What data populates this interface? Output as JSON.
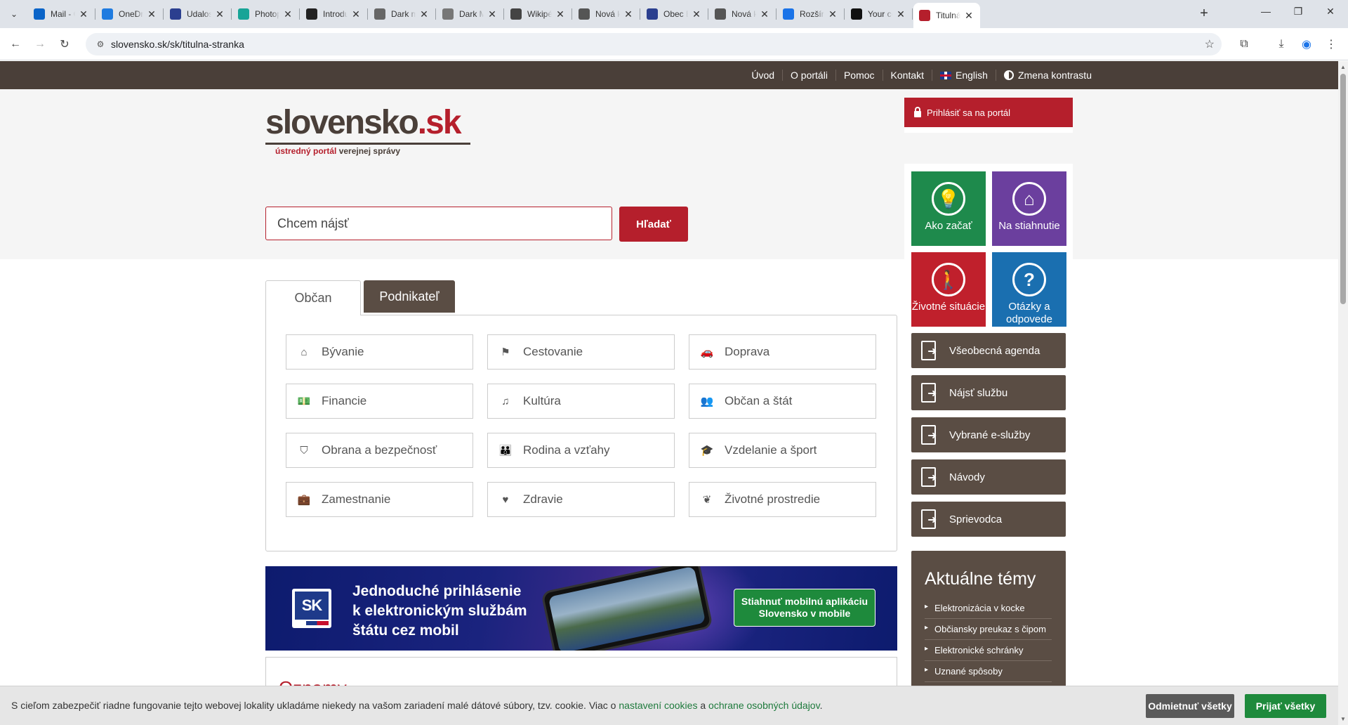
{
  "browser": {
    "tabs": [
      {
        "title": "Mail - Ol",
        "icon": "outlook-icon",
        "color": "#0a64c8"
      },
      {
        "title": "OneDrive",
        "icon": "onedrive-icon",
        "color": "#1f7be0"
      },
      {
        "title": "Udalosti",
        "icon": "coat-of-arms-icon",
        "color": "#2b3f8f"
      },
      {
        "title": "Photope",
        "icon": "photopea-icon",
        "color": "#18a497"
      },
      {
        "title": "Introduc",
        "icon": "openai-icon",
        "color": "#222222"
      },
      {
        "title": "Dark mo",
        "icon": "extension-page-icon",
        "color": "#666666"
      },
      {
        "title": "Dark Mo",
        "icon": "globe-icon",
        "color": "#777777"
      },
      {
        "title": "Wikipédi",
        "icon": "wikipedia-icon",
        "color": "#444444"
      },
      {
        "title": "Nová kar",
        "icon": "chrome-icon",
        "color": "#555555"
      },
      {
        "title": "Obec Ba",
        "icon": "coat-of-arms-icon",
        "color": "#2b3f8f"
      },
      {
        "title": "Nová kar",
        "icon": "chrome-icon",
        "color": "#555555"
      },
      {
        "title": "Rozšíren",
        "icon": "puzzle-icon",
        "color": "#1a73e8"
      },
      {
        "title": "Your con",
        "icon": "notion-icon",
        "color": "#111111"
      },
      {
        "title": "Titulná s",
        "icon": "sk-icon",
        "color": "#b51f2c",
        "active": true
      }
    ],
    "url": "slovensko.sk/sk/titulna-stranka"
  },
  "topnav": {
    "links": [
      "Úvod",
      "O portáli",
      "Pomoc",
      "Kontakt",
      "English",
      "Zmena kontrastu"
    ]
  },
  "logo": {
    "word": "slovensko",
    "tld": ".sk",
    "tagline_a": "ústredný portál",
    "tagline_b": "verejnej správy"
  },
  "search": {
    "placeholder": "Chcem nájsť",
    "button": "Hľadať"
  },
  "login": {
    "label": "Prihlásiť sa na portál"
  },
  "tabs": {
    "citizen": "Občan",
    "business": "Podnikateľ"
  },
  "categories": [
    {
      "label": "Bývanie",
      "icon": "home-icon",
      "glyph": "⌂"
    },
    {
      "label": "Cestovanie",
      "icon": "signpost-icon",
      "glyph": "⚑"
    },
    {
      "label": "Doprava",
      "icon": "car-icon",
      "glyph": "🚗"
    },
    {
      "label": "Financie",
      "icon": "money-icon",
      "glyph": "💵"
    },
    {
      "label": "Kultúra",
      "icon": "music-icon",
      "glyph": "♫"
    },
    {
      "label": "Občan a štát",
      "icon": "users-icon",
      "glyph": "👥"
    },
    {
      "label": "Obrana a bezpečnosť",
      "icon": "shield-icon",
      "glyph": "⛉"
    },
    {
      "label": "Rodina a vzťahy",
      "icon": "family-icon",
      "glyph": "👪"
    },
    {
      "label": "Vzdelanie a šport",
      "icon": "graduation-cap-icon",
      "glyph": "🎓"
    },
    {
      "label": "Zamestnanie",
      "icon": "briefcase-icon",
      "glyph": "💼"
    },
    {
      "label": "Zdravie",
      "icon": "heartbeat-icon",
      "glyph": "♥"
    },
    {
      "label": "Životné prostredie",
      "icon": "leaf-icon",
      "glyph": "❦"
    }
  ],
  "banner": {
    "logo_text": "SK",
    "line1": "Jednoduché prihlásenie",
    "line2": "k elektronickým službám",
    "line3": "štátu cez mobil",
    "btn_line1": "Stiahnuť mobilnú aplikáciu",
    "btn_line2": "Slovensko v mobile"
  },
  "oznamy": {
    "title": "Oznamy"
  },
  "tiles": [
    {
      "label": "Ako začať",
      "color": "#1e8a4c",
      "icon": "lightbulb-icon",
      "glyph": "💡"
    },
    {
      "label": "Na stiahnutie",
      "color": "#6b3f9e",
      "icon": "download-house-icon",
      "glyph": "⌂"
    },
    {
      "label": "Životné situácie",
      "color": "#c0202c",
      "icon": "person-icon",
      "glyph": "🚶"
    },
    {
      "label": "Otázky a odpovede",
      "color": "#1a6fb0",
      "icon": "question-icon",
      "glyph": "?"
    }
  ],
  "sidebar_buttons": [
    "Všeobecná agenda",
    "Nájsť službu",
    "Vybrané e-služby",
    "Návody",
    "Sprievodca"
  ],
  "topics": {
    "title": "Aktuálne témy",
    "items": [
      "Elektronizácia v kocke",
      "Občiansky preukaz s čipom",
      "Elektronické schránky",
      "Uznané spôsoby"
    ]
  },
  "cookie": {
    "text": "S cieľom zabezpečiť riadne fungovanie tejto webovej lokality ukladáme niekedy na vašom zariadení malé dátové súbory, tzv. cookie. Viac o ",
    "link1": "nastavení cookies",
    "mid": " a ",
    "link2": "ochrane osobných údajov",
    "end": ".",
    "reject": "Odmietnuť všetky",
    "accept": "Prijať všetky"
  }
}
